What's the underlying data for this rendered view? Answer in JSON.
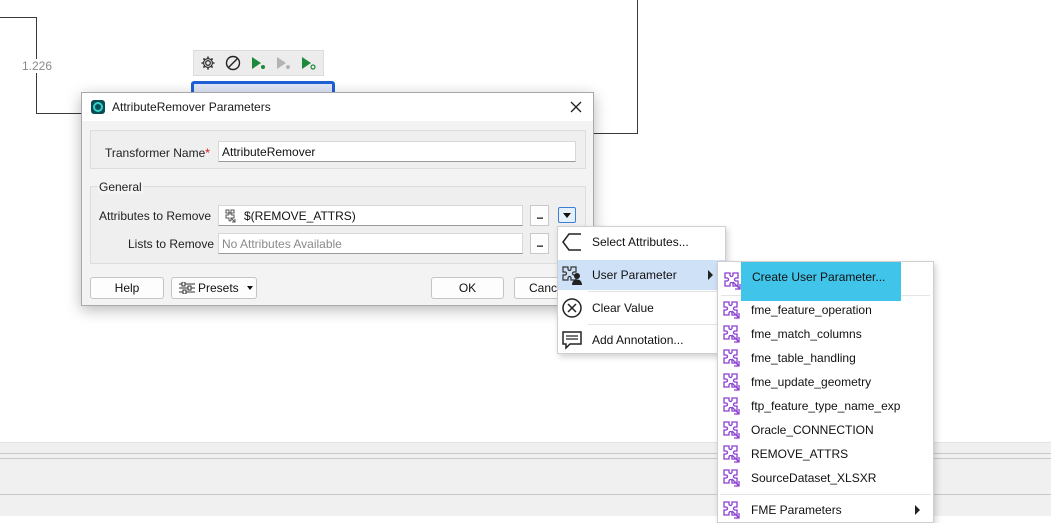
{
  "canvas": {
    "connection_label": "1.226"
  },
  "dialog": {
    "title": "AttributeRemover Parameters",
    "transformer_name_label": "Transformer Name",
    "required_mark": "*",
    "transformer_name_value": "AttributeRemover",
    "group_label": "General",
    "attributes_label": "Attributes to Remove",
    "attributes_value": "$(REMOVE_ATTRS)",
    "lists_label": "Lists to Remove",
    "lists_placeholder": "No Attributes Available",
    "dots": "...",
    "buttons": {
      "help": "Help",
      "presets": "Presets",
      "ok": "OK",
      "cancel": "Canc"
    }
  },
  "context_menu": {
    "items": [
      {
        "label": "Select Attributes...",
        "icon": "select-attributes-icon"
      },
      {
        "label": "User Parameter",
        "icon": "user-parameter-icon",
        "highlighted": true
      },
      {
        "label": "Clear Value",
        "icon": "clear-icon"
      },
      {
        "label": "Add Annotation...",
        "icon": "annotation-icon"
      }
    ]
  },
  "submenu": {
    "create": "Create User Parameter...",
    "items": [
      "fme_feature_operation",
      "fme_match_columns",
      "fme_table_handling",
      "fme_update_geometry",
      "ftp_feature_type_name_exp",
      "Oracle_CONNECTION",
      "REMOVE_ATTRS",
      "SourceDataset_XLSXR"
    ],
    "fme_parameters": "FME Parameters"
  },
  "colors": {
    "accent": "#1f5fd6",
    "highlight": "#cfe1f7",
    "create_highlight": "#40c4ea",
    "param_icon": "#8a3fd1"
  }
}
